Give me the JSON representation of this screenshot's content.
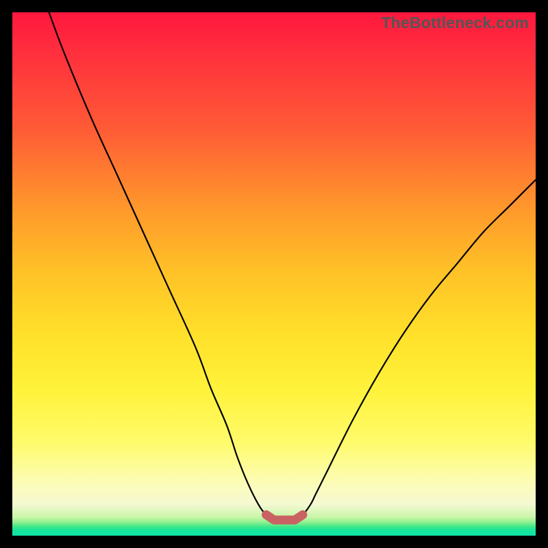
{
  "watermark": "TheBottleneck.com",
  "chart_data": {
    "type": "line",
    "title": "",
    "xlabel": "",
    "ylabel": "",
    "xlim": [
      0,
      100
    ],
    "ylim": [
      0,
      100
    ],
    "series": [
      {
        "name": "bottleneck-curve",
        "x": [
          7,
          10,
          15,
          20,
          25,
          30,
          35,
          38,
          41,
          43,
          45,
          47,
          48.5,
          50,
          52,
          54,
          55.5,
          57,
          58,
          60,
          65,
          70,
          75,
          80,
          85,
          90,
          95,
          100
        ],
        "y": [
          100,
          92,
          80,
          69,
          58,
          47,
          36,
          28,
          21,
          15,
          10,
          6,
          4,
          3,
          3,
          3,
          4,
          6,
          8,
          12,
          22,
          31,
          39,
          46,
          52,
          58,
          63,
          68
        ]
      },
      {
        "name": "optimal-range-marker",
        "x": [
          48.5,
          50,
          52,
          54,
          55.5
        ],
        "y": [
          4,
          3,
          3,
          3,
          4
        ]
      }
    ],
    "colors": {
      "curve": "#000000",
      "marker": "#c96363"
    }
  }
}
